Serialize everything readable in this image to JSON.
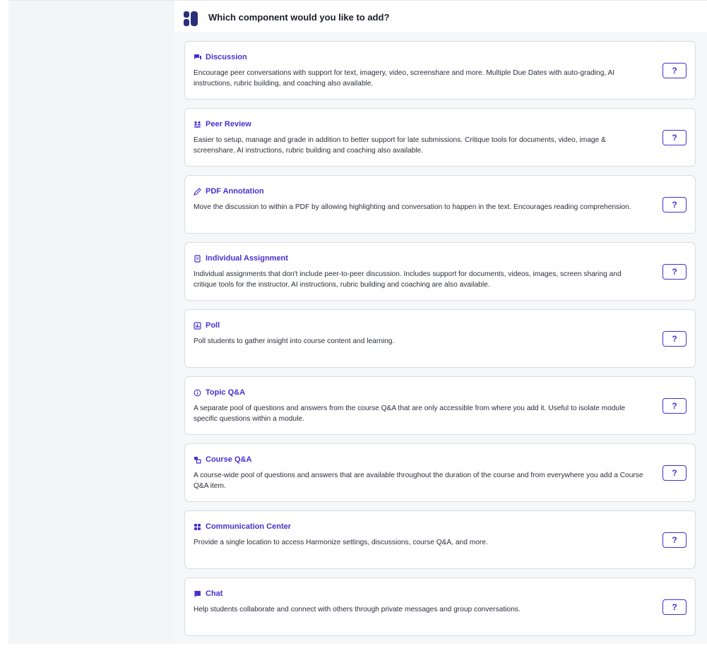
{
  "header": {
    "title": "Which component would you like to add?",
    "logo_icon": "harmonize-logo-icon"
  },
  "colors": {
    "accent": "#4b2ed0",
    "logo": "#2b2f7a",
    "card_border": "#d9dce1",
    "pane_bg": "#f6f7f9"
  },
  "components": [
    {
      "icon": "discussion-icon",
      "title": "Discussion",
      "description": "Encourage peer conversations with support for text, imagery, video, screenshare and more. Multiple Due Dates with auto-grading, AI instructions, rubric building, and coaching also available.",
      "help_label": "?"
    },
    {
      "icon": "peer-review-icon",
      "title": "Peer Review",
      "description": "Easier to setup, manage and grade in addition to better support for late submissions. Critique tools for documents, video, image & screenshare. AI instructions, rubric building and coaching also available.",
      "help_label": "?"
    },
    {
      "icon": "pencil-icon",
      "title": "PDF Annotation",
      "description": "Move the discussion to within a PDF by allowing highlighting and conversation to happen in the text. Encourages reading comprehension.",
      "help_label": "?"
    },
    {
      "icon": "document-icon",
      "title": "Individual Assignment",
      "description": "Individual assignments that don't include peer-to-peer discussion. Includes support for documents, videos, images, screen sharing and critique tools for the instructor. AI instructions, rubric building and coaching are also available.",
      "help_label": "?"
    },
    {
      "icon": "poll-icon",
      "title": "Poll",
      "description": "Poll students to gather insight into course content and learning.",
      "help_label": "?"
    },
    {
      "icon": "info-circle-icon",
      "title": "Topic Q&A",
      "description": "A separate pool of questions and answers from the course Q&A that are only accessible from where you add it. Useful to isolate module specific questions within a module.",
      "help_label": "?"
    },
    {
      "icon": "course-qa-icon",
      "title": "Course Q&A",
      "description": "A course-wide pool of questions and answers that are available throughout the duration of the course and from everywhere you add a Course Q&A item.",
      "help_label": "?"
    },
    {
      "icon": "grid-icon",
      "title": "Communication Center",
      "description": "Provide a single location to access Harmonize settings, discussions, course Q&A, and more.",
      "help_label": "?"
    },
    {
      "icon": "chat-bubble-icon",
      "title": "Chat",
      "description": "Help students collaborate and connect with others through private messages and group conversations.",
      "help_label": "?"
    }
  ]
}
